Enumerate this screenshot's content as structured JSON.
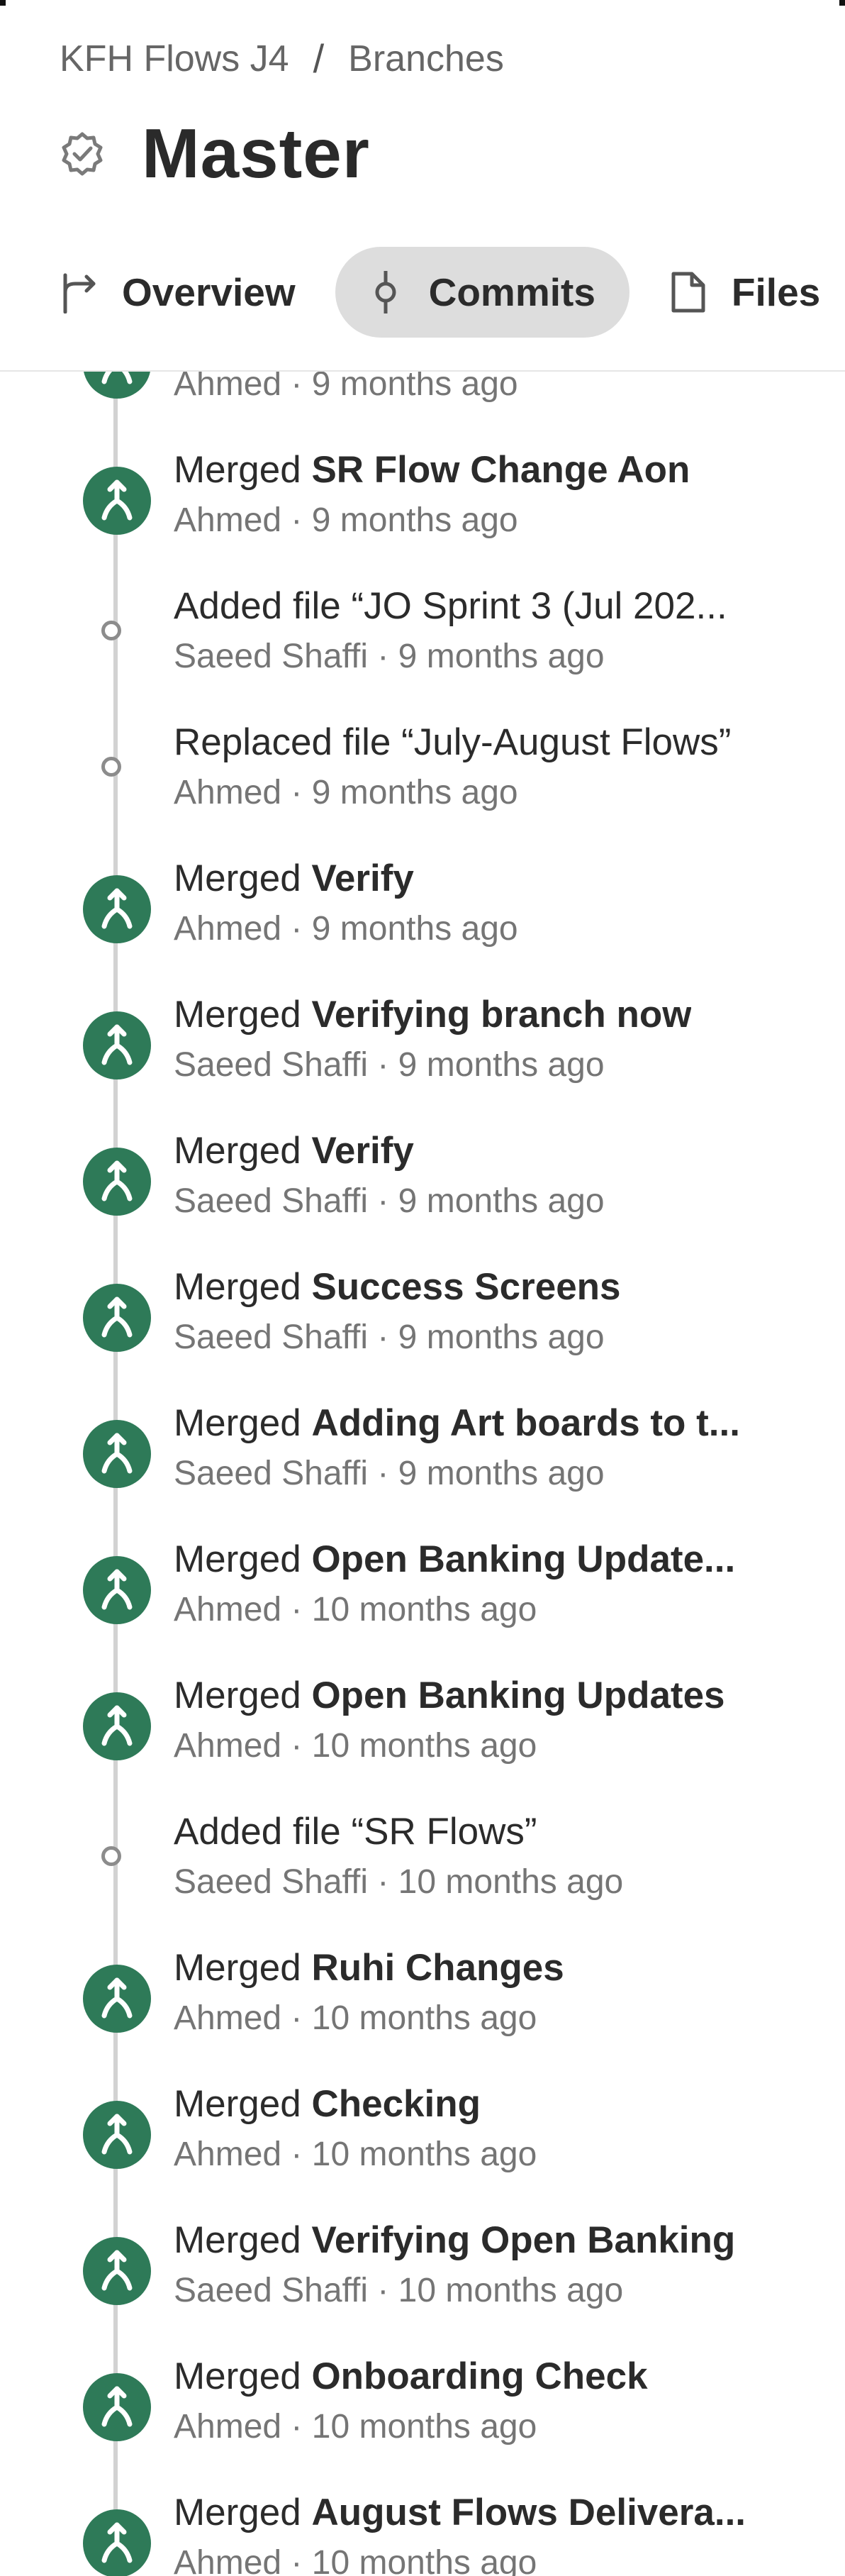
{
  "breadcrumb": {
    "project": "KFH Flows J4",
    "separator": "/",
    "section": "Branches"
  },
  "branch": {
    "title": "Master"
  },
  "tabs": [
    {
      "label": "Overview",
      "icon": "branch-overview-icon"
    },
    {
      "label": "Commits",
      "icon": "commit-icon",
      "active": true
    },
    {
      "label": "Files",
      "icon": "file-icon"
    }
  ],
  "colors": {
    "merge_green": "#2e7a58",
    "timeline": "#d2d2d2",
    "active_tab": "#dddddd"
  },
  "commits": [
    {
      "type": "merge",
      "prefix": "",
      "name": "",
      "author": "Ahmed",
      "time": "9 months ago"
    },
    {
      "type": "merge",
      "prefix": "Merged ",
      "name": "SR Flow Change Aon",
      "author": "Ahmed",
      "time": "9 months ago"
    },
    {
      "type": "file",
      "prefix": "Added file “JO Sprint 3 (Jul 202...",
      "name": "",
      "author": "Saeed Shaffi",
      "time": "9 months ago"
    },
    {
      "type": "file",
      "prefix": "Replaced file “July-August Flows”",
      "name": "",
      "author": "Ahmed",
      "time": "9 months ago"
    },
    {
      "type": "merge",
      "prefix": "Merged ",
      "name": "Verify",
      "author": "Ahmed",
      "time": "9 months ago"
    },
    {
      "type": "merge",
      "prefix": "Merged ",
      "name": "Verifying branch now",
      "author": "Saeed Shaffi",
      "time": "9 months ago"
    },
    {
      "type": "merge",
      "prefix": "Merged ",
      "name": "Verify",
      "author": "Saeed Shaffi",
      "time": "9 months ago"
    },
    {
      "type": "merge",
      "prefix": "Merged ",
      "name": "Success Screens",
      "author": "Saeed Shaffi",
      "time": "9 months ago"
    },
    {
      "type": "merge",
      "prefix": "Merged ",
      "name": "Adding Art boards to t...",
      "author": "Saeed Shaffi",
      "time": "9 months ago"
    },
    {
      "type": "merge",
      "prefix": "Merged ",
      "name": "Open Banking Update...",
      "author": "Ahmed",
      "time": "10 months ago"
    },
    {
      "type": "merge",
      "prefix": "Merged ",
      "name": "Open Banking Updates",
      "author": "Ahmed",
      "time": "10 months ago"
    },
    {
      "type": "file",
      "prefix": "Added file “SR Flows”",
      "name": "",
      "author": "Saeed Shaffi",
      "time": "10 months ago"
    },
    {
      "type": "merge",
      "prefix": "Merged ",
      "name": "Ruhi Changes",
      "author": "Ahmed",
      "time": "10 months ago"
    },
    {
      "type": "merge",
      "prefix": "Merged ",
      "name": "Checking",
      "author": "Ahmed",
      "time": "10 months ago"
    },
    {
      "type": "merge",
      "prefix": "Merged ",
      "name": "Verifying Open Banking",
      "author": "Saeed Shaffi",
      "time": "10 months ago"
    },
    {
      "type": "merge",
      "prefix": "Merged ",
      "name": "Onboarding Check",
      "author": "Ahmed",
      "time": "10 months ago"
    },
    {
      "type": "merge",
      "prefix": "Merged ",
      "name": "August Flows Delivera...",
      "author": "Ahmed",
      "time": "10 months ago"
    }
  ]
}
